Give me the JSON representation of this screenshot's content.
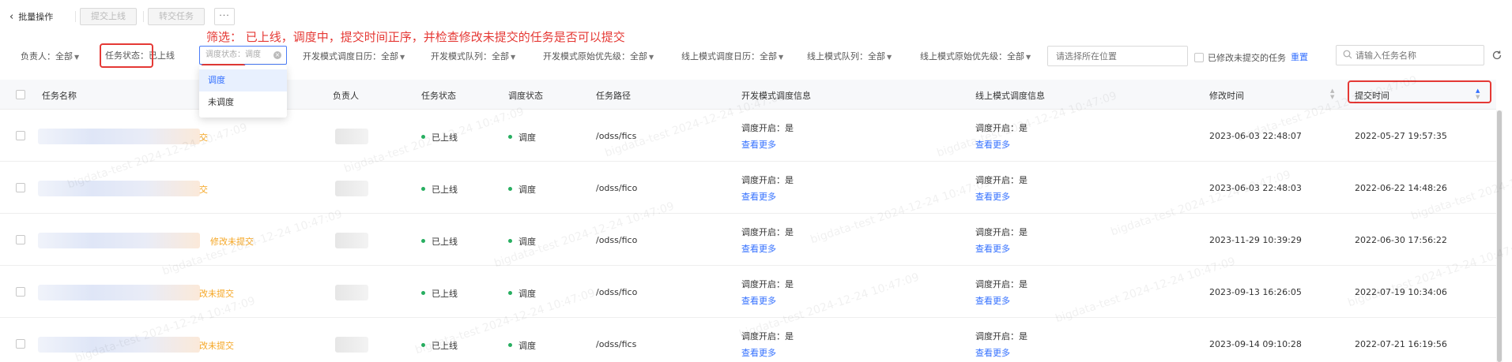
{
  "toolbar": {
    "back_label": "批量操作",
    "submit_online_label": "提交上线",
    "transfer_task_label": "转交任务",
    "more_label": "···"
  },
  "annotation": {
    "text": "筛选：   已上线，调度中，提交时间正序，并检查修改未提交的任务是否可以提交"
  },
  "filters": {
    "owner": "负责人：全部",
    "task_status": "任务状态：已上线",
    "schedule_status": "调度状态：调度",
    "dev_calendar": "开发模式调度日历：全部",
    "dev_queue": "开发模式队列：全部",
    "dev_priority": "开发模式原始优先级：全部",
    "online_calendar": "线上模式调度日历：全部",
    "online_queue": "线上模式队列：全部",
    "online_priority": "线上模式原始优先级：全部",
    "location_placeholder": "请选择所在位置",
    "modified_unsubmitted_label": "已修改未提交的任务",
    "reset_label": "重置",
    "name_placeholder": "请输入任务名称"
  },
  "dropdown": {
    "options": [
      "调度",
      "未调度"
    ],
    "selected": "调度"
  },
  "table": {
    "headers": {
      "name": "任务名称",
      "owner": "负责人",
      "task_status": "任务状态",
      "schedule_status": "调度状态",
      "path": "任务路径",
      "dev_info": "开发模式调度信息",
      "online_info": "线上模式调度信息",
      "modified_time": "修改时间",
      "submit_time": "提交时间"
    },
    "rows": [
      {
        "name_tag": "交",
        "task_status": "已上线",
        "schedule_status": "调度",
        "path": "/odss/fics",
        "dev_schedule": "调度开启：是",
        "dev_more": "查看更多",
        "online_schedule": "调度开启：是",
        "online_more": "查看更多",
        "modified": "2023-06-03 22:48:07",
        "submitted": "2022-05-27 19:57:35"
      },
      {
        "name_tag": "交",
        "task_status": "已上线",
        "schedule_status": "调度",
        "path": "/odss/fico",
        "dev_schedule": "调度开启：是",
        "dev_more": "查看更多",
        "online_schedule": "调度开启：是",
        "online_more": "查看更多",
        "modified": "2023-06-03 22:48:03",
        "submitted": "2022-06-22 14:48:26"
      },
      {
        "name_tag": "修改未提交",
        "task_status": "已上线",
        "schedule_status": "调度",
        "path": "/odss/fico",
        "dev_schedule": "调度开启：是",
        "dev_more": "查看更多",
        "online_schedule": "调度开启：是",
        "online_more": "查看更多",
        "modified": "2023-11-29 10:39:29",
        "submitted": "2022-06-30 17:56:22"
      },
      {
        "name_tag": "改未提交",
        "task_status": "已上线",
        "schedule_status": "调度",
        "path": "/odss/fico",
        "dev_schedule": "调度开启：是",
        "dev_more": "查看更多",
        "online_schedule": "调度开启：是",
        "online_more": "查看更多",
        "modified": "2023-09-13 16:26:05",
        "submitted": "2022-07-19 10:34:06"
      },
      {
        "name_tag": "改未提交",
        "task_status": "已上线",
        "schedule_status": "调度",
        "path": "/odss/fics",
        "dev_schedule": "调度开启：是",
        "dev_more": "查看更多",
        "online_schedule": "调度开启：是",
        "online_more": "查看更多",
        "modified": "2023-09-14 09:10:28",
        "submitted": "2022-07-21 16:19:56"
      }
    ]
  },
  "watermark": "bigdata-test 2024-12-24 10:47:09",
  "colors": {
    "accent": "#3370ff",
    "annotation_red": "#e53935",
    "online_dot": "#27ae60",
    "warning_orange": "#f5a623"
  }
}
